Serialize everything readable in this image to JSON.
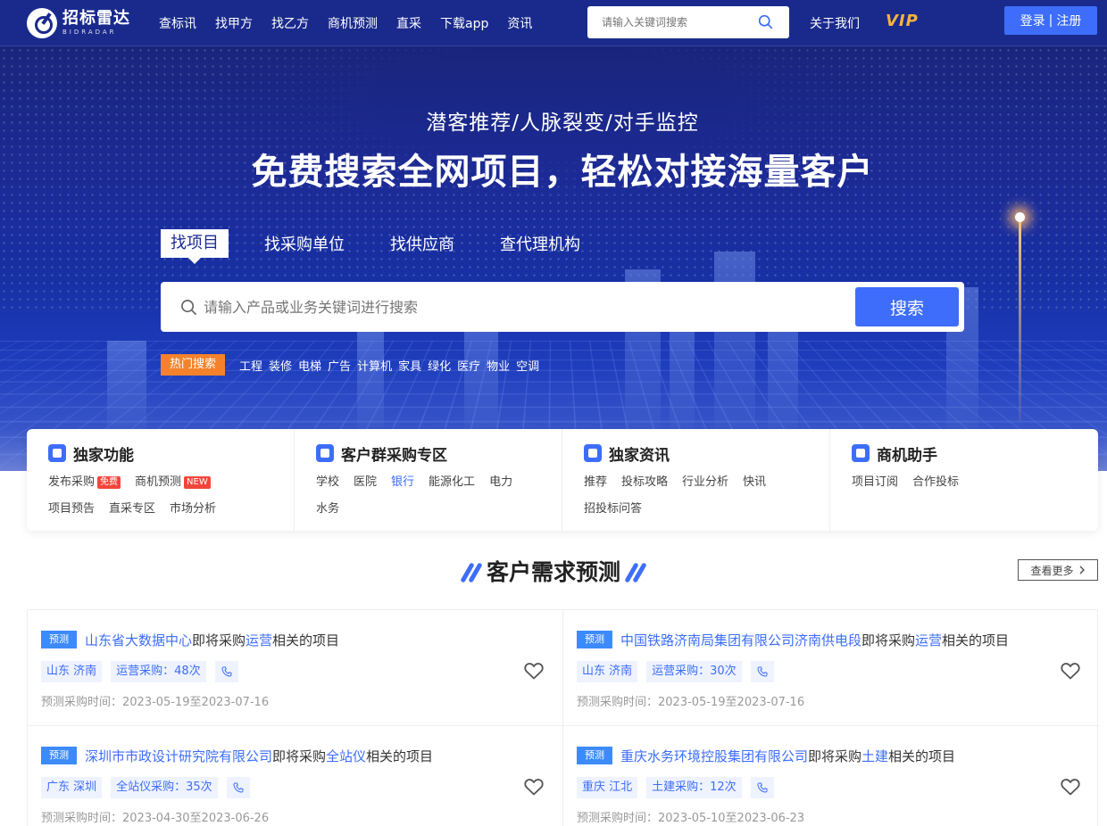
{
  "header": {
    "logo_cn": "招标雷达",
    "logo_en": "BIDRADAR",
    "nav": [
      "查标讯",
      "找甲方",
      "找乙方",
      "商机预测",
      "直采",
      "下载app",
      "资讯"
    ],
    "search_placeholder": "请输入关键词搜索",
    "about": "关于我们",
    "vip": "VIP",
    "login": "登录",
    "register": "注册",
    "divider": "|"
  },
  "hero": {
    "subtitle": "潜客推荐/人脉裂变/对手监控",
    "title": "免费搜索全网项目，轻松对接海量客户",
    "tabs": [
      "找项目",
      "找采购单位",
      "找供应商",
      "查代理机构"
    ],
    "search_placeholder": "请输入产品或业务关键词进行搜索",
    "search_button": "搜索",
    "hot_label": "热门搜索",
    "hot_words": [
      "工程",
      "装修",
      "电梯",
      "广告",
      "计算机",
      "家具",
      "绿化",
      "医疗",
      "物业",
      "空调"
    ]
  },
  "features": [
    {
      "title": "独家功能",
      "links": [
        {
          "label": "发布采购",
          "badge": "免费"
        },
        {
          "label": "商机预测",
          "badge": "NEW"
        },
        {
          "label": "项目预告"
        },
        {
          "label": "直采专区"
        },
        {
          "label": "市场分析"
        }
      ]
    },
    {
      "title": "客户群采购专区",
      "links": [
        {
          "label": "学校"
        },
        {
          "label": "医院"
        },
        {
          "label": "银行",
          "active": true
        },
        {
          "label": "能源化工"
        },
        {
          "label": "电力"
        },
        {
          "label": "水务"
        }
      ]
    },
    {
      "title": "独家资讯",
      "links": [
        {
          "label": "推荐"
        },
        {
          "label": "投标攻略"
        },
        {
          "label": "行业分析"
        },
        {
          "label": "快讯"
        },
        {
          "label": "招投标问答"
        }
      ]
    },
    {
      "title": "商机助手",
      "links": [
        {
          "label": "项目订阅"
        },
        {
          "label": "合作投标"
        }
      ]
    }
  ],
  "section": {
    "title": "客户需求预测",
    "more": "查看更多"
  },
  "cards": [
    {
      "tag": "预测",
      "org": "山东省大数据中心",
      "mid": "即将采购",
      "item": "运营",
      "tail": "相关的项目",
      "region": "山东 济南",
      "purchase": "运营采购：48次",
      "time": "预测采购时间：2023-05-19至2023-07-16"
    },
    {
      "tag": "预测",
      "org": "中国铁路济南局集团有限公司济南供电段",
      "mid": "即将采购",
      "item": "运营",
      "tail": "相关的项目",
      "region": "山东 济南",
      "purchase": "运营采购：30次",
      "time": "预测采购时间：2023-05-19至2023-07-16"
    },
    {
      "tag": "预测",
      "org": "深圳市市政设计研究院有限公司",
      "mid": "即将采购",
      "item": "全站仪",
      "tail": "相关的项目",
      "region": "广东 深圳",
      "purchase": "全站仪采购：35次",
      "time": "预测采购时间：2023-04-30至2023-06-26"
    },
    {
      "tag": "预测",
      "org": "重庆水务环境控股集团有限公司",
      "mid": "即将采购",
      "item": "土建",
      "tail": "相关的项目",
      "region": "重庆 江北",
      "purchase": "土建采购：12次",
      "time": "预测采购时间：2023-05-10至2023-06-23"
    }
  ],
  "colors": {
    "header_bg": "#1a2a8c",
    "accent": "#3d6dfa",
    "hot": "#f5822a",
    "vip": "#f7b23b"
  }
}
